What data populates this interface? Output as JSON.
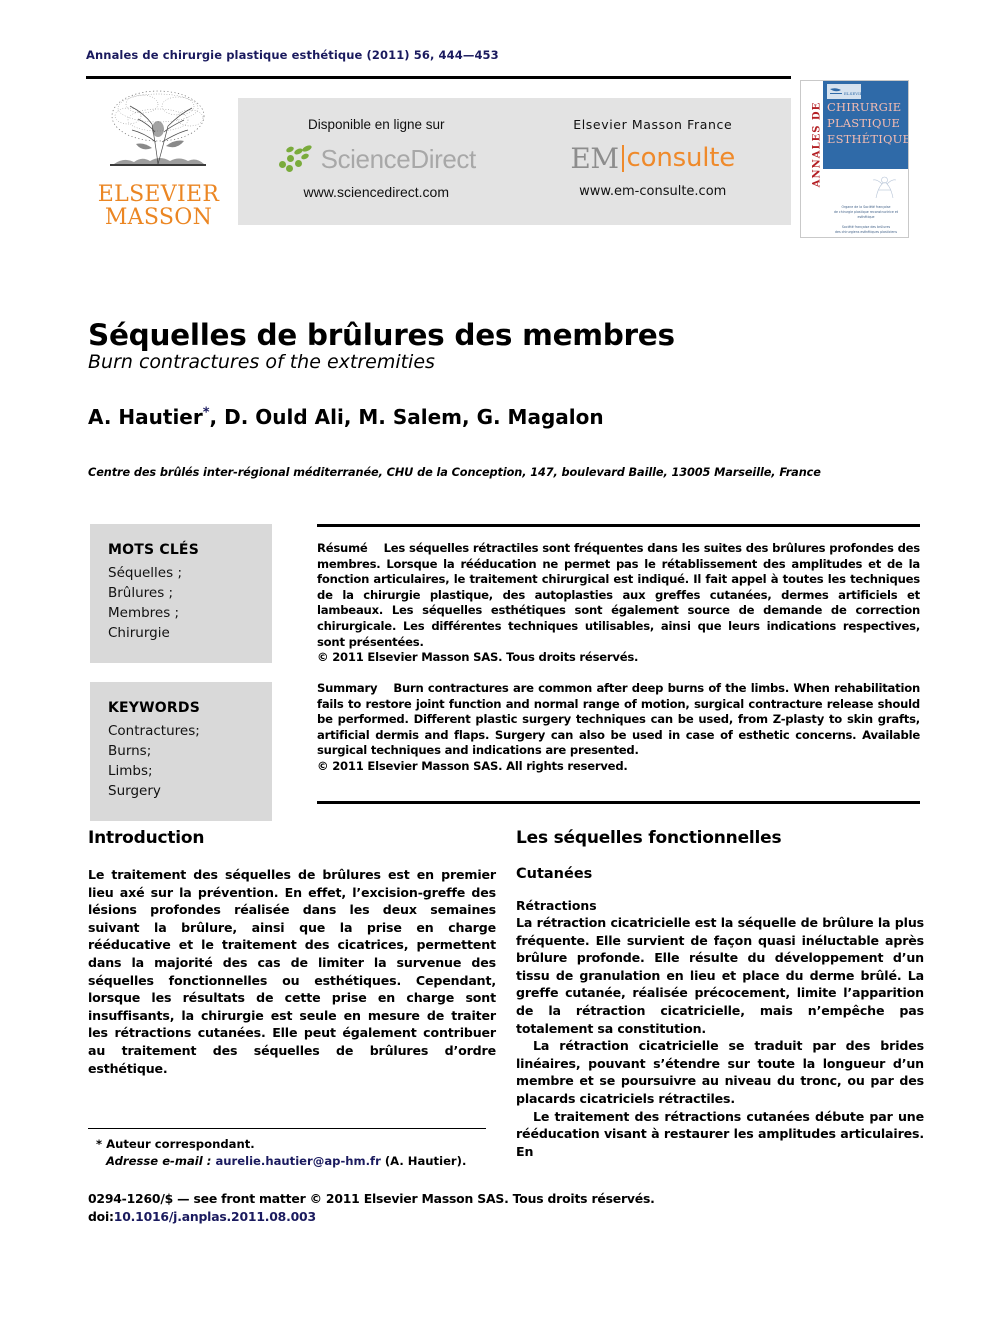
{
  "journal": {
    "running_head": "Annales de chirurgie plastique esthétique (2011) 56, 444—453"
  },
  "banner": {
    "publisher_logo": {
      "line1": "ELSEVIER",
      "line2": "MASSON",
      "icon": "elsevier-tree-logo",
      "color": "#eb8623"
    },
    "sciencedirect": {
      "caption": "Disponible en ligne sur",
      "wordmark": "ScienceDirect",
      "url": "www.sciencedirect.com",
      "leaf_color": "#7aab3c",
      "wordmark_color": "#a8a8a8"
    },
    "emconsulte": {
      "caption": "Elsevier Masson France",
      "wordmark_prefix": "EM",
      "wordmark_suffix": "consulte",
      "url": "www.em-consulte.com",
      "accent_color": "#ef8a2b"
    }
  },
  "cover": {
    "spine_label": "ANNALES DE",
    "title_line1": "CHIRURGIE",
    "title_line2": "PLASTIQUE",
    "title_line3": "ESTHÉTIQUE",
    "smalltext_line1": "Organe de la Société française",
    "smalltext_line2": "de chirurgie plastique reconstructrice et esthétique",
    "smalltext_line3": "Société française des brûlures",
    "smalltext_line4": "des chirurgiens esthétiques plasticiens",
    "background_color": "#2f6aa8",
    "spine_color": "#b42025"
  },
  "article": {
    "title": "Séquelles de brûlures des membres",
    "subtitle": "Burn contractures of the extremities",
    "authors": "A. Hautier",
    "authors_rest": ", D. Ould Ali, M. Salem, G. Magalon",
    "corresponding_marker": "*",
    "affiliation": "Centre des brûlés inter-régional méditerranée, CHU de la Conception, 147, boulevard Baille, 13005 Marseille, France"
  },
  "keywords_fr": {
    "heading": "MOTS CLÉS",
    "items": [
      "Séquelles ;",
      "Brûlures ;",
      "Membres ;",
      "Chirurgie"
    ]
  },
  "keywords_en": {
    "heading": "KEYWORDS",
    "items": [
      "Contractures;",
      "Burns;",
      "Limbs;",
      "Surgery"
    ]
  },
  "abstract_fr": {
    "label": "Résumé",
    "text": "Les séquelles rétractiles sont fréquentes dans les suites des brûlures profondes des membres. Lorsque la rééducation ne permet pas le rétablissement des amplitudes et de la fonction articulaires, le traitement chirurgical est indiqué. Il fait appel à toutes les techniques de la chirurgie plastique, des autoplasties aux greffes cutanées, dermes artificiels et lambeaux. Les séquelles esthétiques sont également source de demande de correction chirurgicale. Les différentes techniques utilisables, ainsi que leurs indications respectives, sont présentées.",
    "copyright": "© 2011 Elsevier Masson SAS. Tous droits réservés."
  },
  "abstract_en": {
    "label": "Summary",
    "text": "Burn contractures are common after deep burns of the limbs. When rehabilitation fails to restore joint function and normal range of motion, surgical contracture release should be performed. Different plastic surgery techniques can be used, from Z-plasty to skin grafts, artificial dermis and flaps. Surgery can also be used in case of esthetic concerns. Available surgical techniques and indications are presented.",
    "copyright": "© 2011 Elsevier Masson SAS. All rights reserved."
  },
  "body": {
    "left_column": {
      "heading": "Introduction",
      "paragraphs": [
        "Le traitement des séquelles de brûlures est en premier lieu axé sur la prévention. En effet, l’excision-greffe des lésions profondes réalisée dans les deux semaines suivant la brûlure, ainsi que la prise en charge rééducative et le traitement des cicatrices, permettent dans la majorité des cas de limiter la survenue des séquelles fonctionnelles ou esthétiques. Cependant, lorsque les résultats de cette prise en charge sont insuffisants, la chirurgie est seule en mesure de traiter les rétractions cutanées. Elle peut également contribuer au traitement des séquelles de brûlures d’ordre esthétique."
      ]
    },
    "right_column": {
      "heading": "Les séquelles fonctionnelles",
      "subheading": "Cutanées",
      "subsubheading": "Rétractions",
      "paragraphs": [
        "La rétraction cicatricielle est la séquelle de brûlure la plus fréquente. Elle survient de façon quasi inéluctable après brûlure profonde. Elle résulte du développement d’un tissu de granulation en lieu et place du derme brûlé. La greffe cutanée, réalisée précocement, limite l’apparition de la rétraction cicatricielle, mais n’empêche pas totalement sa constitution.",
        "La rétraction cicatricielle se traduit par des brides linéaires, pouvant s’étendre sur toute la longueur d’un membre et se poursuivre au niveau du tronc, ou par des placards cicatriciels rétractiles.",
        "Le traitement des rétractions cutanées débute par une rééducation visant à restaurer les amplitudes articulaires. En"
      ]
    }
  },
  "footnote": {
    "marker": "*",
    "line1": "Auteur correspondant.",
    "email_label": "Adresse e-mail :",
    "email": "aurelie.hautier@ap-hm.fr",
    "email_suffix": "(A. Hautier)."
  },
  "footer": {
    "front_matter": "0294-1260/$ — see front matter © 2011 Elsevier Masson SAS. Tous droits réservés.",
    "doi_prefix": "doi:",
    "doi": "10.1016/j.anplas.2011.08.003"
  }
}
